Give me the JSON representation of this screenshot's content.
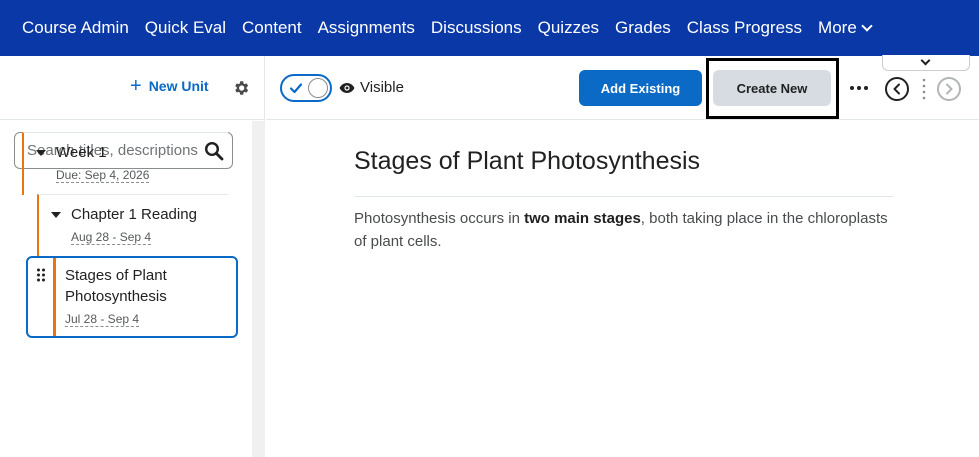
{
  "navbar": {
    "items": [
      "Course Admin",
      "Quick Eval",
      "Content",
      "Assignments",
      "Discussions",
      "Quizzes",
      "Grades",
      "Class Progress"
    ],
    "more_label": "More"
  },
  "sidebar": {
    "new_unit_label": "New Unit",
    "search_placeholder": "Search titles, descriptions",
    "tree": [
      {
        "title": "Week 1",
        "date": "Due: Sep 4, 2026"
      },
      {
        "title": "Chapter 1 Reading",
        "date": "Aug 28 - Sep 4"
      },
      {
        "title_line1": "Stages of Plant",
        "title_line2": "Photosynthesis",
        "date": "Jul 28 - Sep 4"
      }
    ]
  },
  "toolbar": {
    "visible_label": "Visible",
    "visible_on": true,
    "add_existing_label": "Add Existing",
    "create_new_label": "Create New"
  },
  "content": {
    "title": "Stages of Plant Photosynthesis",
    "body_before": "Photosynthesis occurs in ",
    "body_bold": "two main stages",
    "body_after": ", both taking place in the chloroplasts of plant cells."
  },
  "colors": {
    "navbar": "#0a38a6",
    "accent": "#0a6ac6",
    "tree_bar": "#e87511",
    "highlight_box": "#000000"
  }
}
